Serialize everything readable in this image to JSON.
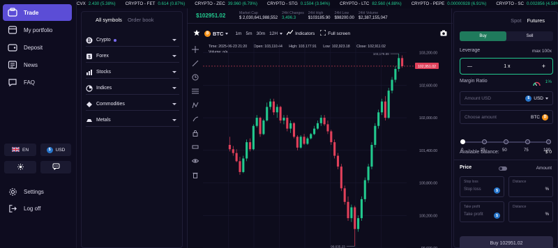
{
  "ticker": [
    {
      "sym": "CVX",
      "val": "2.430 (5.38%)"
    },
    {
      "sym": "CRYPTO - FET",
      "val": "0.614 (0.87%)"
    },
    {
      "sym": "CRYPTO - ZEC",
      "val": "39.960 (6.79%)"
    },
    {
      "sym": "CRYPTO - STG",
      "val": "0.1504 (3.94%)"
    },
    {
      "sym": "CRYPTO - LTC",
      "val": "82.560 (4.88%)"
    },
    {
      "sym": "CRYPTO - PEPE",
      "val": "0.00000928 (6.91%)"
    },
    {
      "sym": "CRYPTO - SC",
      "val": "0.002856 (4.58%)"
    }
  ],
  "nav": {
    "items": [
      {
        "label": "Trade",
        "icon": "trade-icon",
        "active": true
      },
      {
        "label": "My portfolio",
        "icon": "portfolio-icon"
      },
      {
        "label": "Deposit",
        "icon": "deposit-icon"
      },
      {
        "label": "News",
        "icon": "news-icon"
      },
      {
        "label": "FAQ",
        "icon": "faq-icon"
      }
    ],
    "lang": "EN",
    "currency": "USD",
    "settings": "Settings",
    "logout": "Log off"
  },
  "symbols": {
    "tab_all": "All symbols",
    "tab_orders": "Order book",
    "categories": [
      {
        "label": "Crypto",
        "icon": "bitcoin-icon"
      },
      {
        "label": "Forex",
        "icon": "forex-icon"
      },
      {
        "label": "Stocks",
        "icon": "stocks-icon"
      },
      {
        "label": "Indices",
        "icon": "indices-icon"
      },
      {
        "label": "Commodities",
        "icon": "commodities-icon"
      },
      {
        "label": "Metals",
        "icon": "metals-icon"
      }
    ]
  },
  "chart_header": {
    "price": "$102951.02",
    "market_cap_label": "Market Cap",
    "market_cap": "$ 2,030,641,988,552",
    "change_label": "24H Changes",
    "change": "3,496.3",
    "high_label": "24H High",
    "high": "$103185.90",
    "low_label": "24H Low",
    "low": "$98200.00",
    "volume_label": "24H Volume",
    "volume": "$2,387,155,047"
  },
  "toolbar": {
    "symbol": "BTC",
    "timeframes": [
      "1m",
      "5m",
      "30m",
      "12H"
    ],
    "indicators": "Indicators",
    "fullscreen": "Full screen"
  },
  "ohlc": {
    "time_label": "Time:",
    "time": "2025-06-23 21:20",
    "open_label": "Open:",
    "open": "103,110.44",
    "high_label": "High:",
    "high": "103,177.91",
    "low_label": "Low:",
    "low": "102,923.18",
    "close_label": "Close:",
    "close": "102,911.02",
    "volume_label": "Volume:",
    "volume": "n/a"
  },
  "chart_data": {
    "type": "candlestick",
    "ylim": [
      99600,
      103400
    ],
    "y_ticks": [
      "103,200.00",
      "102,600.00",
      "102,000.00",
      "101,400.00",
      "100,800.00",
      "100,200.00",
      "99,600.00"
    ],
    "y_tick_values": [
      103200,
      102600,
      102000,
      101400,
      100800,
      100200,
      99600
    ],
    "current_price": 102951.02,
    "current_price_label": "102,951.02",
    "max_label": "103,179.89",
    "max_value": 103179.89,
    "min_label": "99,635.23",
    "min_value": 99635.23,
    "candles": [
      [
        101500,
        101650,
        101380,
        101420
      ],
      [
        101420,
        101480,
        101300,
        101350
      ],
      [
        101350,
        101420,
        101180,
        101200
      ],
      [
        101200,
        101280,
        100950,
        101000
      ],
      [
        101000,
        101300,
        100980,
        101250
      ],
      [
        101250,
        101600,
        101200,
        101550
      ],
      [
        101550,
        101620,
        101380,
        101420
      ],
      [
        101420,
        101880,
        101400,
        101850
      ],
      [
        101850,
        102050,
        101820,
        102000
      ],
      [
        102000,
        102020,
        101650,
        101700
      ],
      [
        101700,
        101980,
        101680,
        101950
      ],
      [
        101950,
        102280,
        101930,
        102200
      ],
      [
        102200,
        102350,
        102150,
        102300
      ],
      [
        102300,
        102350,
        102050,
        102100
      ],
      [
        102100,
        102250,
        102000,
        102200
      ],
      [
        102200,
        102220,
        101900,
        101950
      ],
      [
        101950,
        102050,
        101880,
        102000
      ],
      [
        102000,
        102050,
        101750,
        101800
      ],
      [
        101800,
        101950,
        101720,
        101900
      ],
      [
        101900,
        101920,
        101620,
        101650
      ],
      [
        101650,
        101680,
        101400,
        101450
      ],
      [
        101450,
        101680,
        101430,
        101650
      ],
      [
        101650,
        101700,
        101500,
        101520
      ],
      [
        101520,
        101650,
        101500,
        101620
      ],
      [
        101620,
        101720,
        101600,
        101700
      ],
      [
        101700,
        101850,
        101680,
        101800
      ],
      [
        101800,
        101950,
        101780,
        101900
      ],
      [
        101900,
        102050,
        101850,
        102000
      ],
      [
        102000,
        102050,
        101850,
        101880
      ],
      [
        101880,
        101950,
        101700,
        101750
      ],
      [
        101750,
        101780,
        101500,
        101550
      ],
      [
        101550,
        101600,
        101250,
        101300
      ],
      [
        101300,
        101350,
        101050,
        101100
      ],
      [
        101100,
        101150,
        100650,
        100700
      ],
      [
        100700,
        100750,
        100400,
        100450
      ],
      [
        100450,
        100550,
        100100,
        100150
      ],
      [
        100150,
        100400,
        100080,
        100350
      ],
      [
        100350,
        100380,
        99635,
        99950
      ],
      [
        99950,
        100200,
        99900,
        100150
      ],
      [
        100150,
        100550,
        100100,
        100500
      ],
      [
        100500,
        100900,
        100450,
        100850
      ],
      [
        100850,
        101150,
        100800,
        101100
      ],
      [
        101100,
        101550,
        101050,
        101500
      ],
      [
        101500,
        101900,
        101450,
        101850
      ],
      [
        101850,
        102150,
        101800,
        102100
      ],
      [
        102100,
        102350,
        102050,
        102300
      ],
      [
        102300,
        102400,
        101950,
        102000
      ],
      [
        102000,
        102550,
        101980,
        102500
      ],
      [
        102500,
        102750,
        102450,
        102700
      ],
      [
        102700,
        102950,
        102650,
        102900
      ],
      [
        102900,
        103180,
        102850,
        103100
      ],
      [
        103100,
        103150,
        102920,
        102951
      ]
    ]
  },
  "trade": {
    "tab_spot": "Spot",
    "tab_futures": "Futures",
    "buy": "Buy",
    "sell": "Sell",
    "leverage_label": "Leverage",
    "leverage_max": "max 100x",
    "leverage_value": "1 x",
    "minus": "—",
    "plus": "+",
    "margin_label": "Margin Ratio",
    "margin_value": "1%",
    "amount_usd_placeholder": "Amount USD",
    "amount_usd_unit": "USD",
    "amount_coin_placeholder": "Choose amount",
    "amount_coin_unit": "BTC",
    "slider_labels": [
      "0",
      "25",
      "50",
      "75",
      "100"
    ],
    "slider_value_percent": 0,
    "balance_label": "Available balance:",
    "balance_value": "$ 0",
    "price_label": "Price",
    "price_mode": "Amount",
    "stop_loss_label": "Stop loss",
    "stop_loss_placeholder": "Stop loss",
    "take_profit_label": "Take profit",
    "take_profit_placeholder": "Take profit",
    "distance_label": "Distance",
    "distance_unit": "%",
    "buy_button": "Buy 102951.02",
    "colors": {
      "up": "#22c98e",
      "down": "#e0405a",
      "accent": "#5b4dd6"
    }
  }
}
